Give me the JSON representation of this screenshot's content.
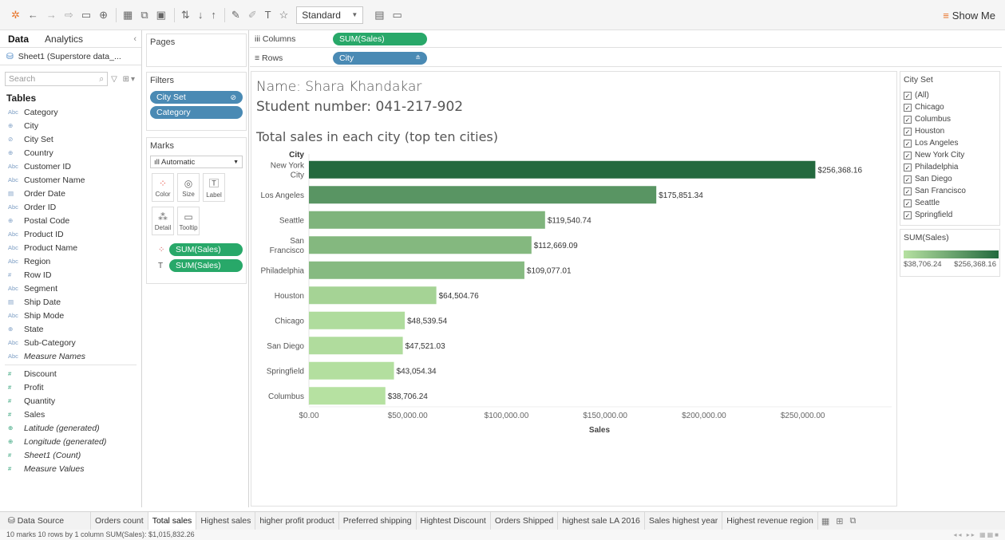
{
  "toolbar": {
    "fit_select": "Standard",
    "show_me": "Show Me"
  },
  "data_panel": {
    "tabs": [
      "Data",
      "Analytics"
    ],
    "datasource": "Sheet1 (Superstore data_...",
    "search_placeholder": "Search",
    "tables_heading": "Tables",
    "dimensions": [
      {
        "icon": "Abc",
        "name": "Category"
      },
      {
        "icon": "⊕",
        "name": "City"
      },
      {
        "icon": "⊘",
        "name": "City Set"
      },
      {
        "icon": "⊕",
        "name": "Country"
      },
      {
        "icon": "Abc",
        "name": "Customer ID"
      },
      {
        "icon": "Abc",
        "name": "Customer Name"
      },
      {
        "icon": "▤",
        "name": "Order Date"
      },
      {
        "icon": "Abc",
        "name": "Order ID"
      },
      {
        "icon": "⊕",
        "name": "Postal Code"
      },
      {
        "icon": "Abc",
        "name": "Product ID"
      },
      {
        "icon": "Abc",
        "name": "Product Name"
      },
      {
        "icon": "Abc",
        "name": "Region"
      },
      {
        "icon": "#",
        "name": "Row ID"
      },
      {
        "icon": "Abc",
        "name": "Segment"
      },
      {
        "icon": "▤",
        "name": "Ship Date"
      },
      {
        "icon": "Abc",
        "name": "Ship Mode"
      },
      {
        "icon": "⊕",
        "name": "State"
      },
      {
        "icon": "Abc",
        "name": "Sub-Category"
      },
      {
        "icon": "Abc",
        "name": "Measure Names"
      }
    ],
    "measures": [
      {
        "icon": "#",
        "name": "Discount"
      },
      {
        "icon": "#",
        "name": "Profit"
      },
      {
        "icon": "#",
        "name": "Quantity"
      },
      {
        "icon": "#",
        "name": "Sales"
      },
      {
        "icon": "⊕",
        "name": "Latitude (generated)"
      },
      {
        "icon": "⊕",
        "name": "Longitude (generated)"
      },
      {
        "icon": "#",
        "name": "Sheet1 (Count)"
      },
      {
        "icon": "#",
        "name": "Measure Values"
      }
    ]
  },
  "pages_label": "Pages",
  "filters": {
    "label": "Filters",
    "pills": [
      "City Set",
      "Category"
    ]
  },
  "marks": {
    "label": "Marks",
    "type": "Automatic",
    "buttons": [
      "Color",
      "Size",
      "Label",
      "Detail",
      "Tooltip"
    ],
    "pills": [
      "SUM(Sales)",
      "SUM(Sales)"
    ]
  },
  "shelves": {
    "columns_label": "Columns",
    "columns_pill": "SUM(Sales)",
    "rows_label": "Rows",
    "rows_pill": "City"
  },
  "view": {
    "name_line": "Name: Shara Khandakar",
    "student_line": "Student number: 041-217-902"
  },
  "city_set_legend": {
    "title": "City Set",
    "items": [
      "(All)",
      "Chicago",
      "Columbus",
      "Houston",
      "Los Angeles",
      "New York City",
      "Philadelphia",
      "San Diego",
      "San Francisco",
      "Seattle",
      "Springfield"
    ]
  },
  "color_legend": {
    "title": "SUM(Sales)",
    "min_label": "$38,706.24",
    "max_label": "$256,368.16",
    "colors": {
      "low": "#b6e1a1",
      "high": "#23693e"
    }
  },
  "chart_data": {
    "type": "bar",
    "title": "Total sales in each city (top ten cities)",
    "ylabel": "City",
    "xlabel": "Sales",
    "categories": [
      "New York City",
      "Los Angeles",
      "Seattle",
      "San Francisco",
      "Philadelphia",
      "Houston",
      "Chicago",
      "San Diego",
      "Springfield",
      "Columbus"
    ],
    "category_display": [
      [
        "New York",
        "City"
      ],
      [
        "Los Angeles"
      ],
      [
        "Seattle"
      ],
      [
        "San",
        "Francisco"
      ],
      [
        "Philadelphia"
      ],
      [
        "Houston"
      ],
      [
        "Chicago"
      ],
      [
        "San Diego"
      ],
      [
        "Springfield"
      ],
      [
        "Columbus"
      ]
    ],
    "values": [
      256368.16,
      175851.34,
      119540.74,
      112669.09,
      109077.01,
      64504.76,
      48539.54,
      47521.03,
      43054.34,
      38706.24
    ],
    "value_labels": [
      "$256,368.16",
      "$175,851.34",
      "$119,540.74",
      "$112,669.09",
      "$109,077.01",
      "$64,504.76",
      "$48,539.54",
      "$47,521.03",
      "$43,054.34",
      "$38,706.24"
    ],
    "xticks": [
      0,
      50000,
      100000,
      150000,
      200000,
      250000
    ],
    "xtick_labels": [
      "$0.00",
      "$50,000.00",
      "$100,000.00",
      "$150,000.00",
      "$200,000.00",
      "$250,000.00"
    ],
    "xlim": [
      0,
      295000
    ],
    "orientation": "horizontal",
    "color_range": [
      "#b6e1a1",
      "#23693e"
    ]
  },
  "sheet_tabs": {
    "data_source": "Data Source",
    "tabs": [
      "Orders count",
      "Total sales",
      "Highest sales",
      "higher profit product",
      "Preferred shipping",
      "Hightest Discount",
      "Orders Shipped",
      "highest sale LA 2016",
      "Sales highest year",
      "Highest revenue region"
    ],
    "active_index": 1
  },
  "status": {
    "text": "10 marks   10 rows by 1 column   SUM(Sales): $1,015,832.26"
  }
}
